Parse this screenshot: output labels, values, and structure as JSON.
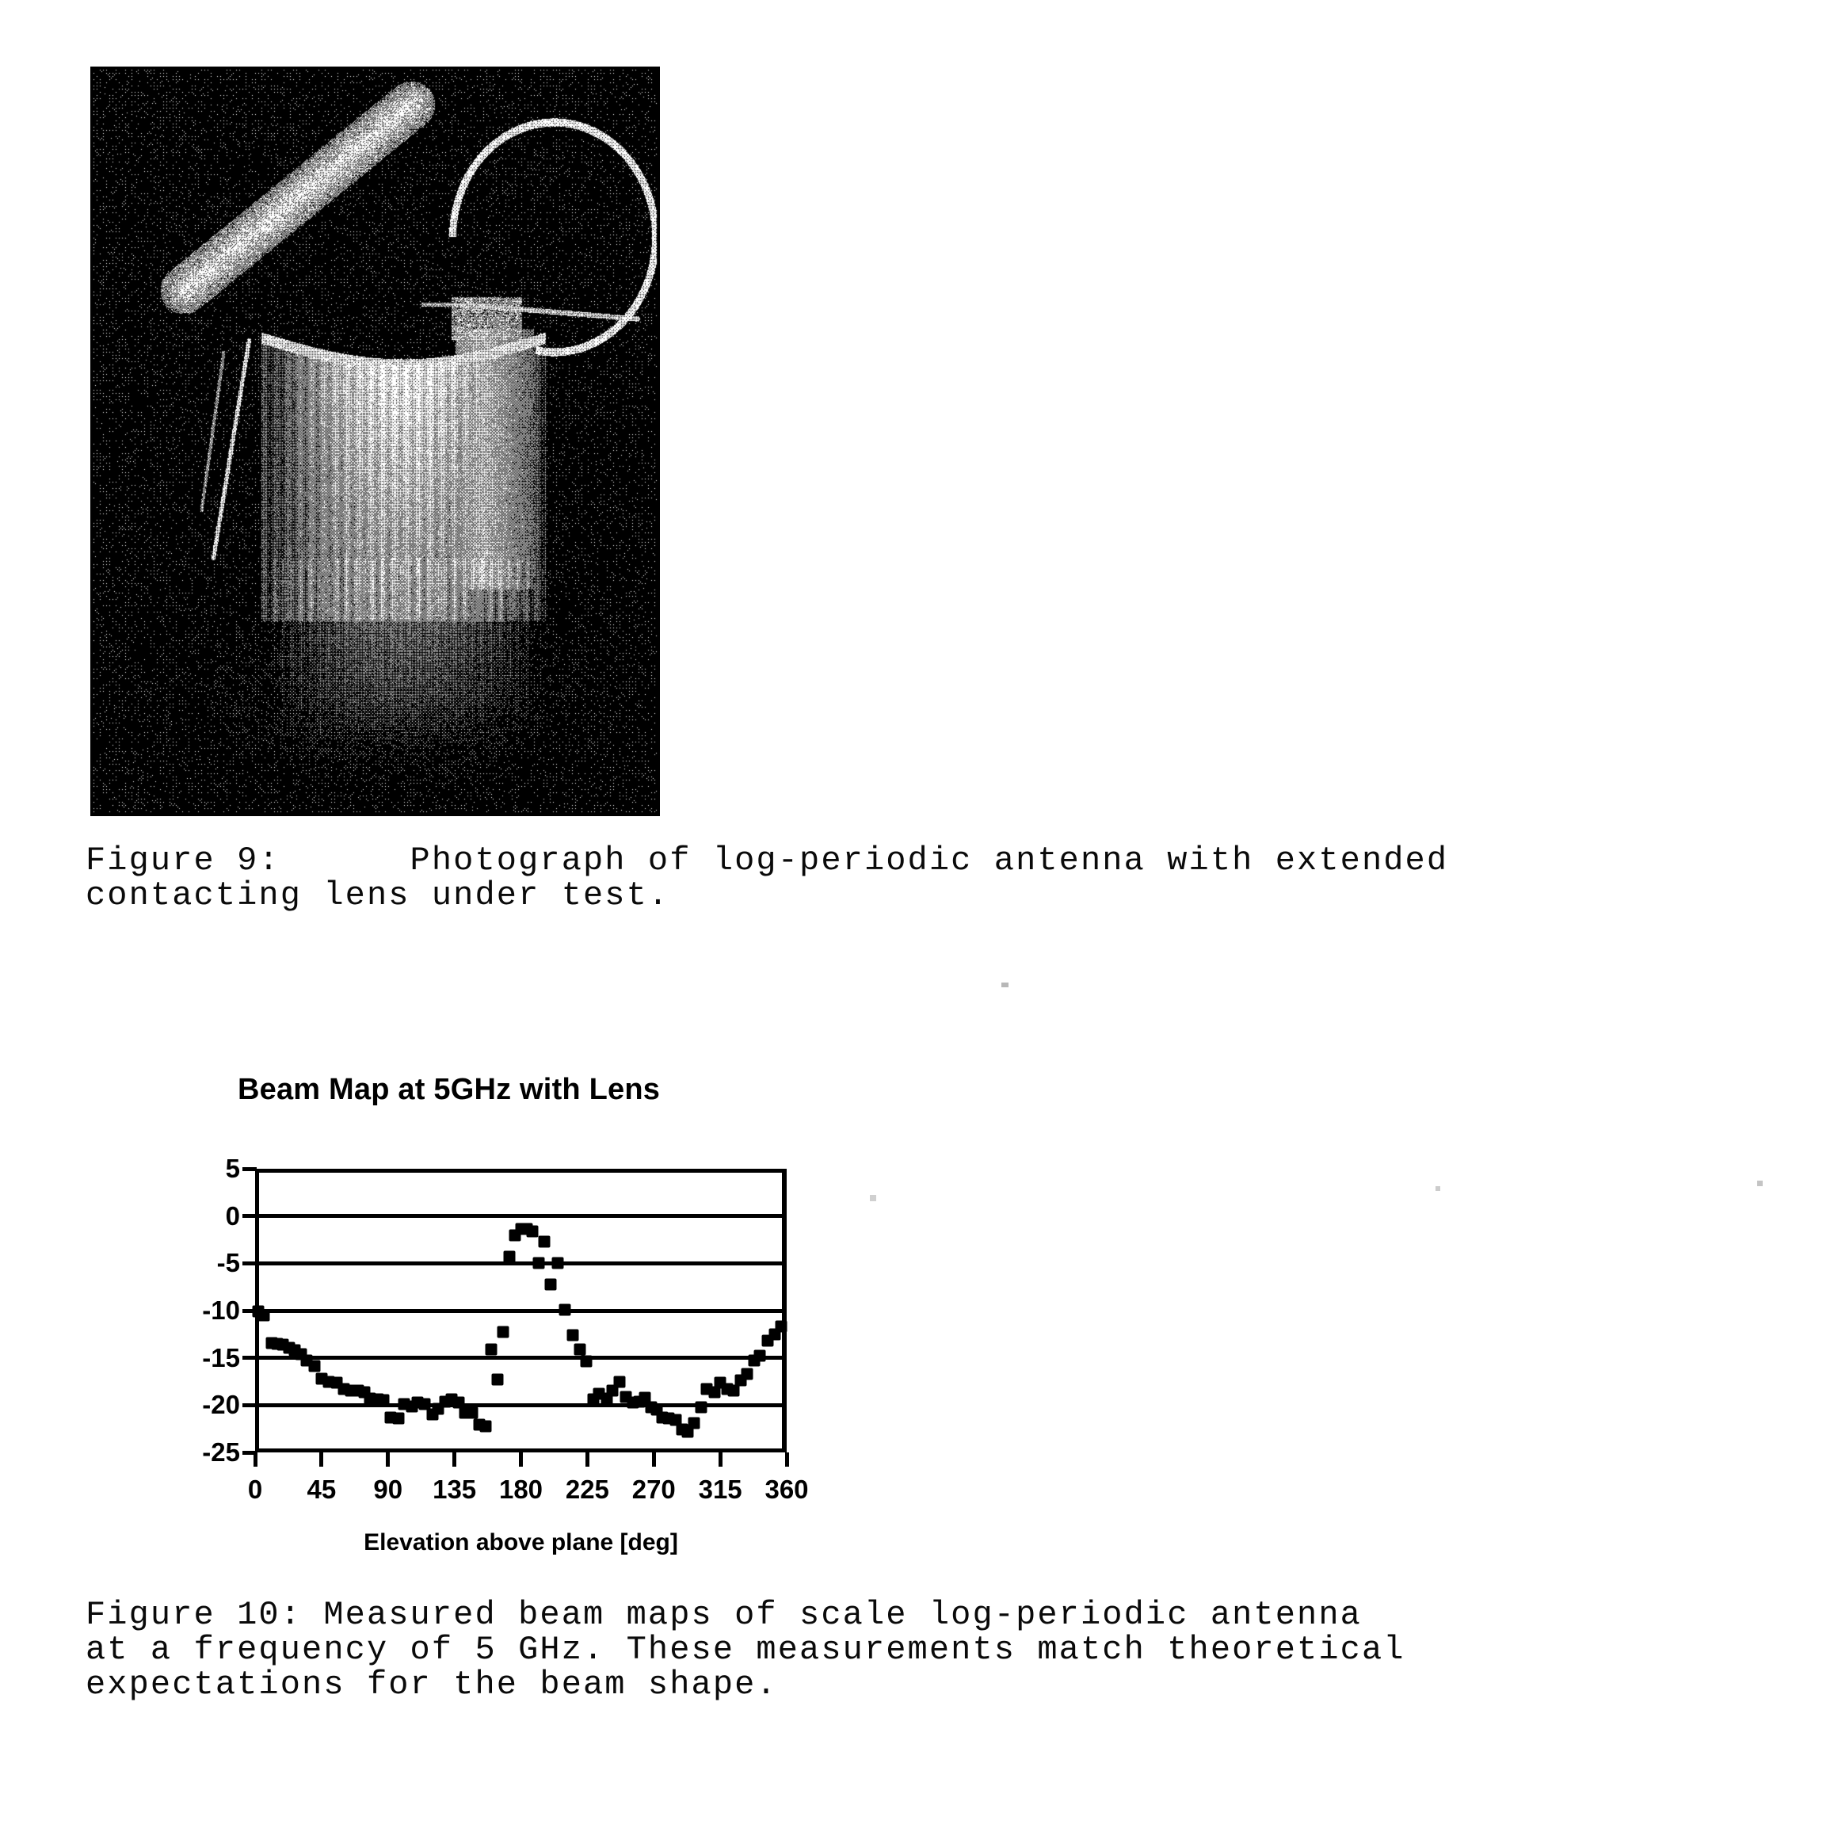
{
  "figure9": {
    "image_name": "photograph-log-periodic-antenna",
    "alt": "Photograph of log-periodic antenna with extended contacting lens under test",
    "caption_line1": "Figure 9:      Photograph of log-periodic antenna with extended",
    "caption_line2": "contacting lens under test."
  },
  "figure10": {
    "caption_line1": "Figure 10: Measured beam maps of scale log-periodic antenna",
    "caption_line2": "at a frequency of 5 GHz. These measurements match theoretical",
    "caption_line3": "expectations for the beam shape."
  },
  "chart_data": {
    "type": "scatter",
    "title": "Beam Map at 5GHz with Lens",
    "xlabel": "Elevation above plane [deg]",
    "ylabel": "",
    "xlim": [
      0,
      360
    ],
    "ylim": [
      -25,
      5
    ],
    "xticks": [
      0,
      45,
      90,
      135,
      180,
      225,
      270,
      315,
      360
    ],
    "xtick_labels": [
      "0",
      "45",
      "90",
      "135",
      "180",
      "225",
      "270",
      "315",
      "360"
    ],
    "yticks": [
      5,
      0,
      -5,
      -10,
      -15,
      -20,
      -25
    ],
    "ytick_labels": [
      "5",
      "0",
      "-5",
      "-10",
      "-15",
      "-20",
      "-25"
    ],
    "grid": "horizontal",
    "legend": "none",
    "marker": "square",
    "x": [
      2,
      6,
      11,
      15,
      19,
      23,
      27,
      31,
      35,
      40,
      45,
      50,
      55,
      60,
      65,
      70,
      74,
      78,
      83,
      87,
      92,
      97,
      101,
      106,
      110,
      115,
      120,
      124,
      129,
      133,
      138,
      142,
      147,
      152,
      156,
      160,
      164,
      168,
      172,
      176,
      180,
      184,
      188,
      192,
      196,
      200,
      205,
      210,
      215,
      220,
      224,
      229,
      233,
      238,
      242,
      247,
      251,
      256,
      260,
      264,
      268,
      272,
      276,
      280,
      285,
      289,
      293,
      297,
      302,
      306,
      311,
      315,
      320,
      324,
      329,
      333,
      338,
      342,
      347,
      352,
      356
    ],
    "y": [
      -10.1,
      -10.5,
      -13.4,
      -13.5,
      -13.6,
      -13.9,
      -14.2,
      -14.6,
      -15.3,
      -15.9,
      -17.2,
      -17.5,
      -17.6,
      -18.3,
      -18.5,
      -18.5,
      -18.6,
      -19.3,
      -19.4,
      -19.5,
      -21.3,
      -21.4,
      -19.9,
      -20.1,
      -19.7,
      -19.9,
      -21.0,
      -20.4,
      -19.6,
      -19.4,
      -19.7,
      -20.8,
      -20.8,
      -22.1,
      -22.2,
      -14.1,
      -17.3,
      -12.3,
      -4.3,
      -2.0,
      -1.4,
      -1.4,
      -1.6,
      -5.0,
      -2.7,
      -7.2,
      -5.0,
      -9.9,
      -12.6,
      -14.1,
      -15.4,
      -19.4,
      -18.8,
      -19.3,
      -18.5,
      -17.5,
      -19.1,
      -19.7,
      -19.6,
      -19.2,
      -20.2,
      -20.5,
      -21.3,
      -21.4,
      -21.6,
      -22.6,
      -22.8,
      -21.9,
      -20.2,
      -18.3,
      -18.6,
      -17.6,
      -18.3,
      -18.5,
      -17.4,
      -16.7,
      -15.3,
      -14.8,
      -13.2,
      -12.5,
      -11.7
    ]
  }
}
